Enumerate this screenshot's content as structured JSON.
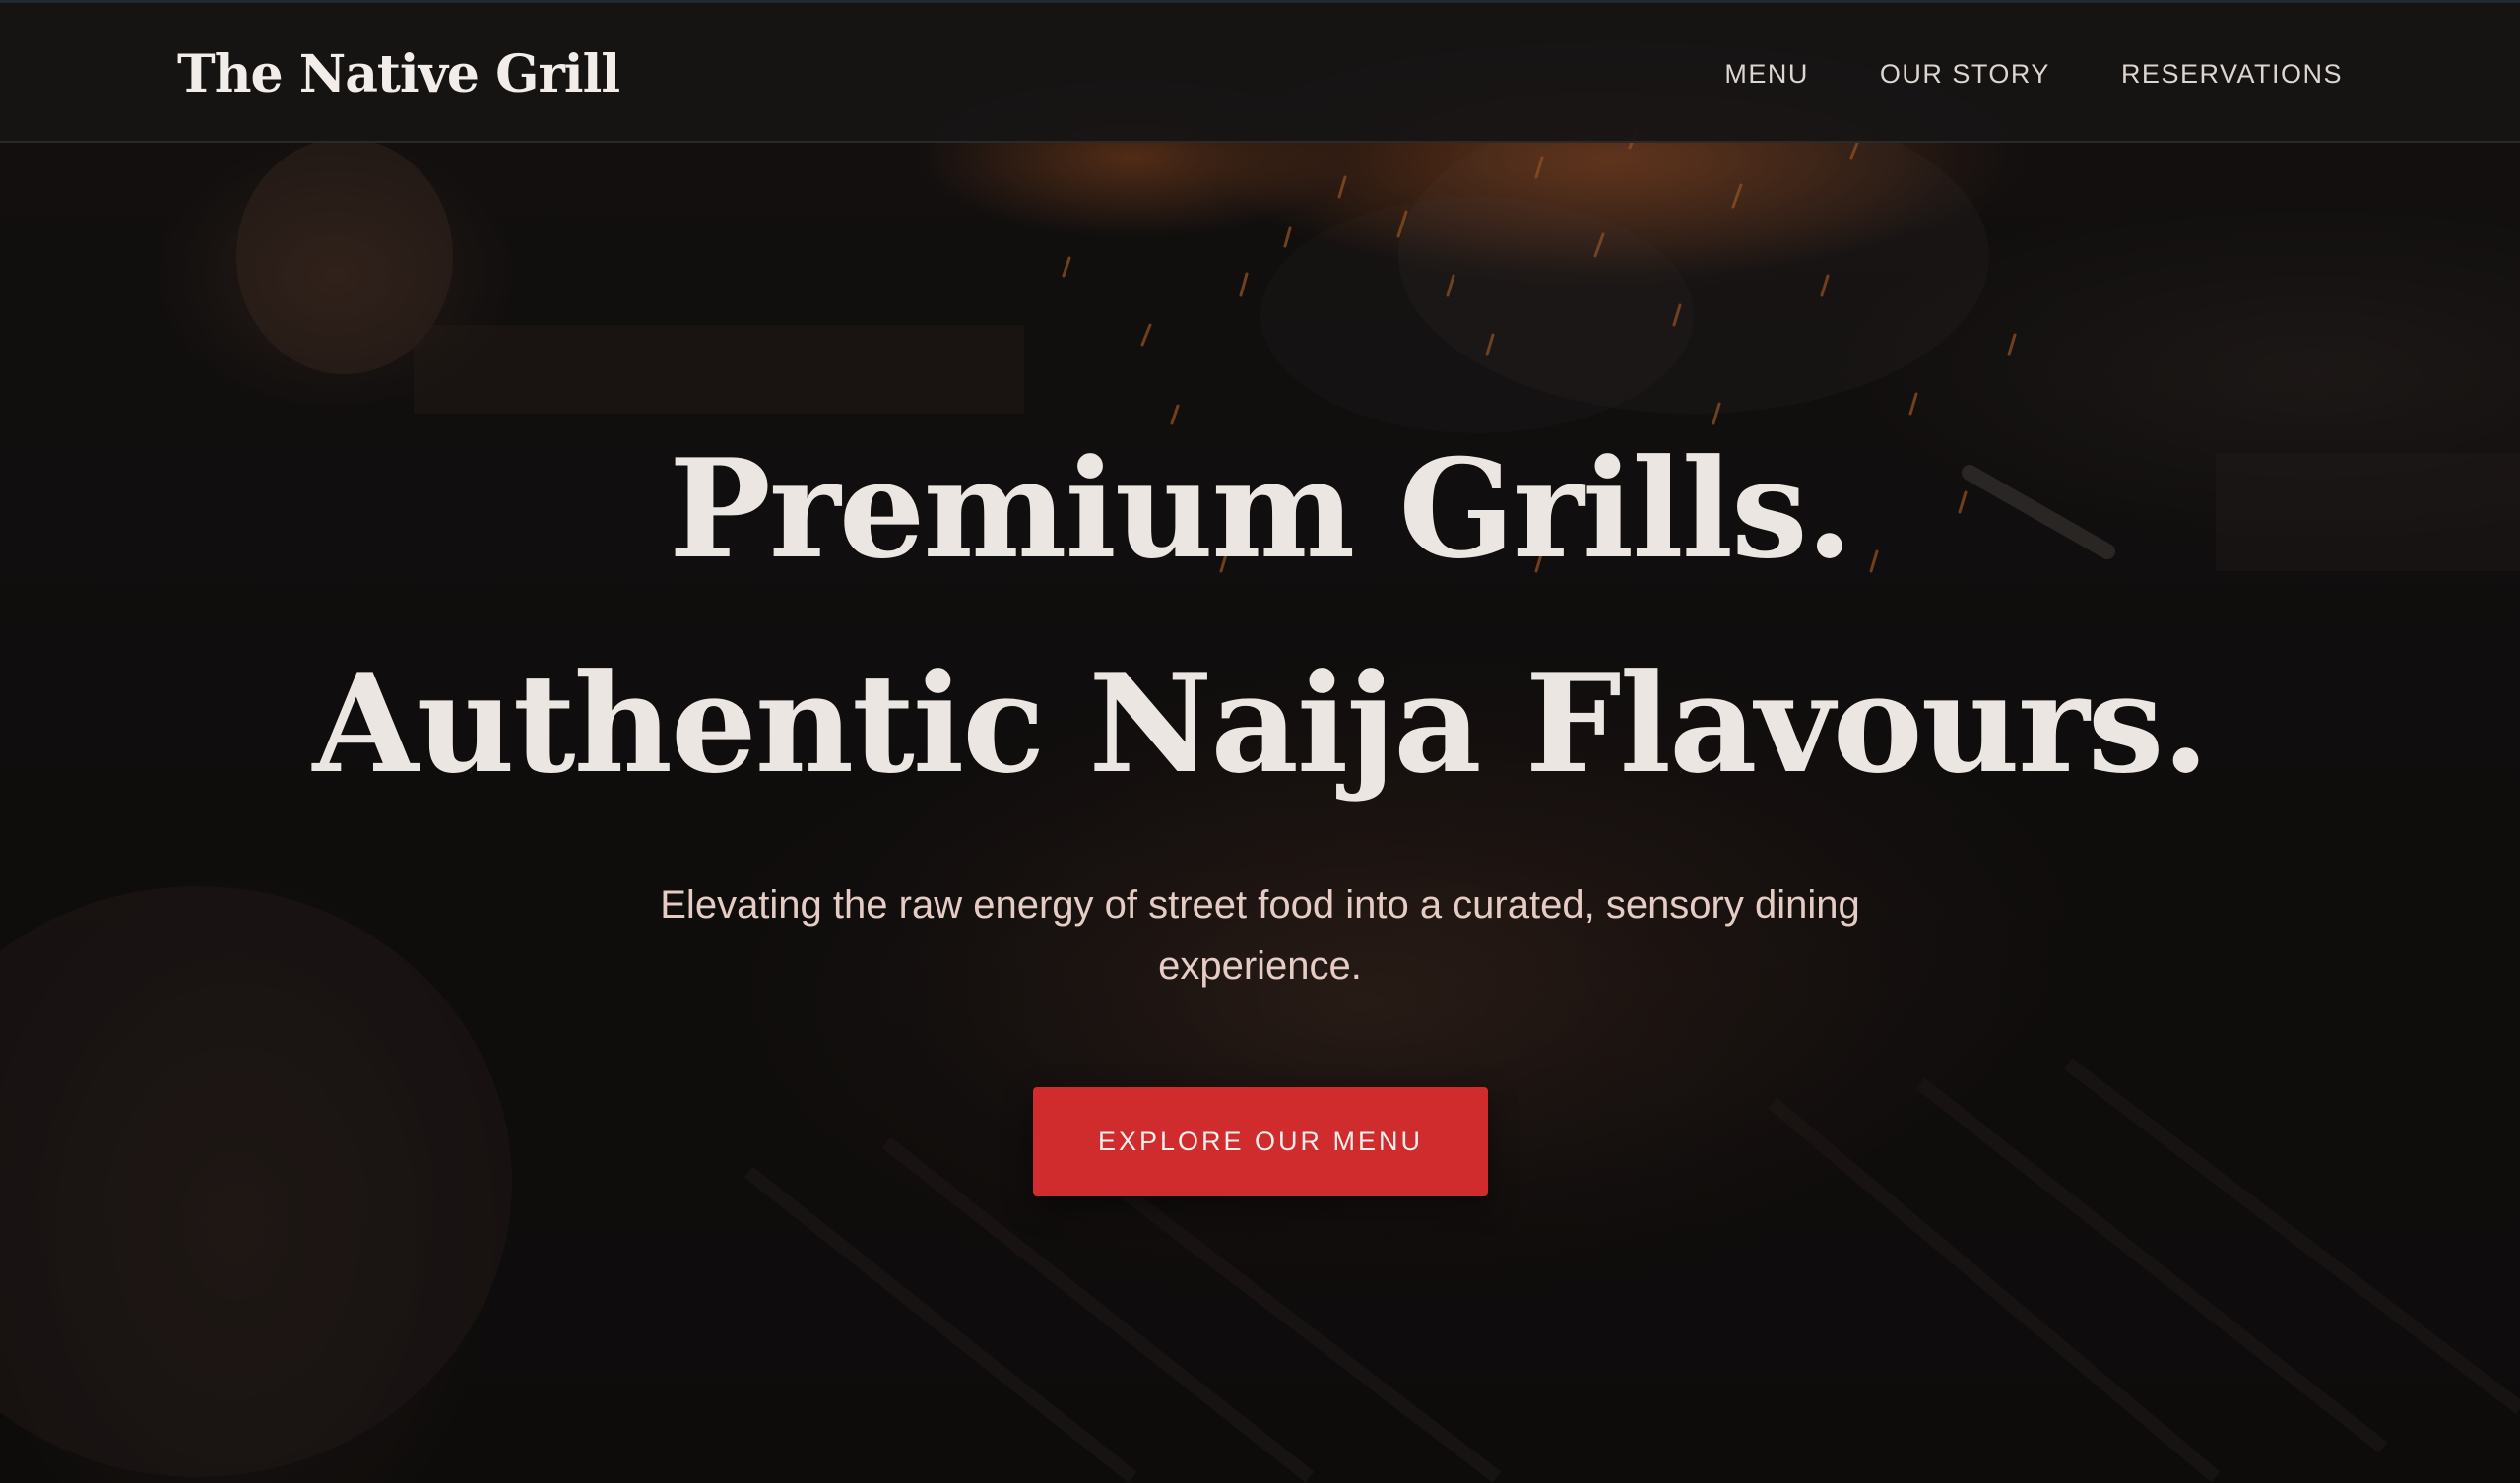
{
  "brand": {
    "name": "The Native Grill"
  },
  "nav": {
    "items": [
      {
        "label": "MENU"
      },
      {
        "label": "OUR STORY"
      },
      {
        "label": "RESERVATIONS"
      }
    ]
  },
  "hero": {
    "headline_line_1": "Premium Grills.",
    "headline_line_2": "Authentic Naija Flavours.",
    "subtitle": "Elevating the raw energy of street food into a curated, sensory dining experience.",
    "cta_label": "EXPLORE OUR MENU",
    "background_image": "grill-flames-photo"
  },
  "colors": {
    "background": "#121010",
    "navbar": "#161414",
    "headline": "#ece6e3",
    "subtitle": "#e5ccc4",
    "accent": "#d02c2e"
  }
}
